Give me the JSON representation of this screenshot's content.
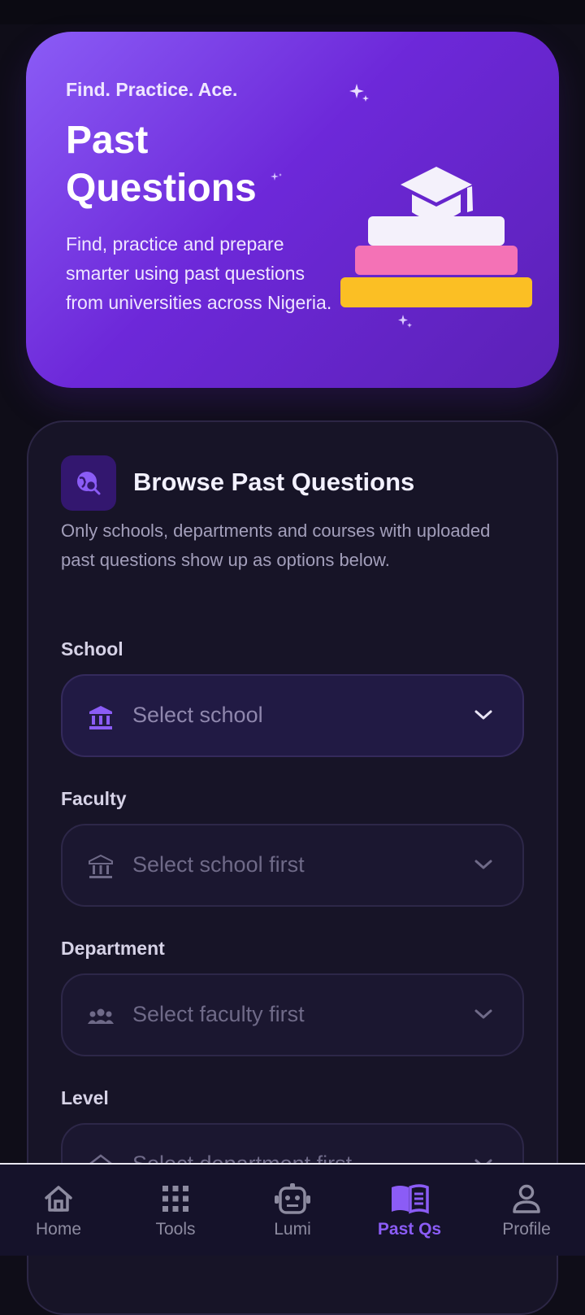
{
  "hero": {
    "tagline": "Find. Practice. Ace.",
    "title": "Past Questions",
    "description": "Find, practice and prepare smarter using past questions from universities across Nigeria."
  },
  "browse": {
    "title": "Browse Past Questions",
    "description": "Only schools, departments and courses with uploaded past questions show up as options below.",
    "fields": [
      {
        "label": "School",
        "placeholder": "Select school",
        "icon": "school-building-icon"
      },
      {
        "label": "Faculty",
        "placeholder": "Select school first",
        "icon": "faculty-building-icon"
      },
      {
        "label": "Department",
        "placeholder": "Select faculty first",
        "icon": "people-group-icon"
      },
      {
        "label": "Level",
        "placeholder": "Select department first",
        "icon": "level-layers-icon"
      }
    ]
  },
  "nav": {
    "items": [
      {
        "label": "Home",
        "icon": "home-icon"
      },
      {
        "label": "Tools",
        "icon": "grid-icon"
      },
      {
        "label": "Lumi",
        "icon": "robot-icon"
      },
      {
        "label": "Past Qs",
        "icon": "open-book-icon"
      },
      {
        "label": "Profile",
        "icon": "person-icon"
      }
    ],
    "active": "Past Qs"
  },
  "colors": {
    "accent": "#8b5cf6",
    "hero_gradient_start": "#8b5cf6",
    "hero_gradient_end": "#5b21b6",
    "book_white": "#f4f1fb",
    "book_pink": "#f472b6",
    "book_yellow": "#fbbf24"
  }
}
